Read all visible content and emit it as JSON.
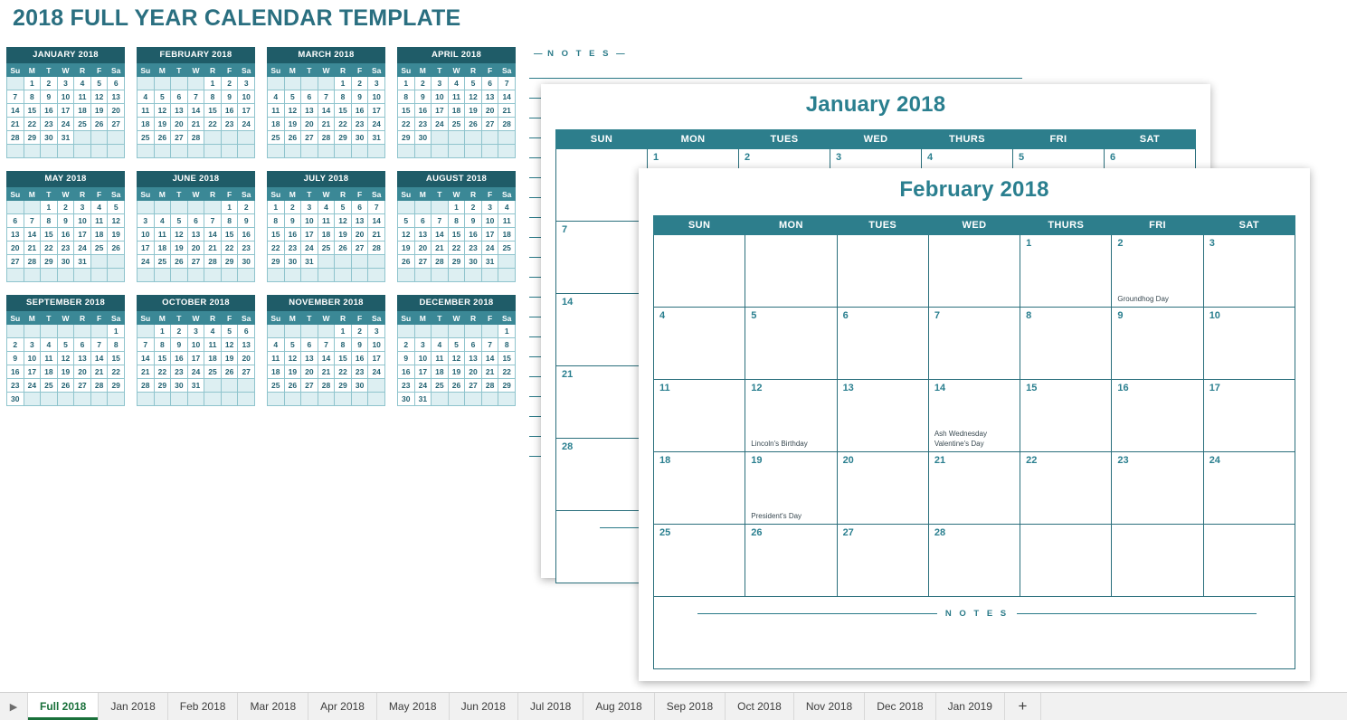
{
  "page_title": "2018 FULL YEAR CALENDAR TEMPLATE",
  "colors": {
    "brand_teal": "#2a7f8f",
    "mini_title_bg": "#1f5c68",
    "mini_header_bg": "#3b8896",
    "big_header_bg": "#2d7e8c",
    "shaded_cell": "#b4dbe2",
    "pad_cell": "#ddeff2",
    "notes_panel": "#dceff3",
    "active_tab_green": "#19703a"
  },
  "notes_panel": {
    "label": "N O T E S",
    "dash_left": "—",
    "dash_right": "—",
    "line_count": 20
  },
  "mini_calendar": {
    "weekday_headers": [
      "Su",
      "M",
      "T",
      "W",
      "R",
      "F",
      "Sa"
    ],
    "months": [
      {
        "title": "JANUARY 2018",
        "lead_blanks": 1,
        "days": 31
      },
      {
        "title": "FEBRUARY 2018",
        "lead_blanks": 4,
        "days": 28
      },
      {
        "title": "MARCH 2018",
        "lead_blanks": 4,
        "days": 31
      },
      {
        "title": "APRIL 2018",
        "lead_blanks": 0,
        "days": 30
      },
      {
        "title": "MAY 2018",
        "lead_blanks": 2,
        "days": 31
      },
      {
        "title": "JUNE 2018",
        "lead_blanks": 5,
        "days": 30
      },
      {
        "title": "JULY 2018",
        "lead_blanks": 0,
        "days": 31
      },
      {
        "title": "AUGUST 2018",
        "lead_blanks": 3,
        "days": 31
      },
      {
        "title": "SEPTEMBER 2018",
        "lead_blanks": 6,
        "days": 30
      },
      {
        "title": "OCTOBER 2018",
        "lead_blanks": 1,
        "days": 31
      },
      {
        "title": "NOVEMBER 2018",
        "lead_blanks": 4,
        "days": 30
      },
      {
        "title": "DECEMBER 2018",
        "lead_blanks": 6,
        "days": 31
      }
    ]
  },
  "big_weekday_headers": [
    "SUN",
    "MON",
    "TUES",
    "WED",
    "THURS",
    "FRI",
    "SAT"
  ],
  "windows": [
    {
      "id": "january",
      "heading": "January 2018",
      "lead_blanks": 1,
      "days": 31,
      "weeks": 5,
      "events": {},
      "notes_label": "N O T E S"
    },
    {
      "id": "february",
      "heading": "February 2018",
      "lead_blanks": 4,
      "days": 28,
      "weeks": 5,
      "events": {
        "2": [
          "Groundhog Day"
        ],
        "12": [
          "Lincoln's Birthday"
        ],
        "14": [
          "Ash Wednesday",
          "Valentine's Day"
        ],
        "19": [
          "President's Day"
        ]
      },
      "notes_label": "N O T E S"
    }
  ],
  "tabbar": {
    "nav_icon": "▶",
    "add_label": "+",
    "tabs": [
      {
        "label": "Full 2018",
        "active": true
      },
      {
        "label": "Jan 2018",
        "active": false
      },
      {
        "label": "Feb 2018",
        "active": false
      },
      {
        "label": "Mar 2018",
        "active": false
      },
      {
        "label": "Apr 2018",
        "active": false
      },
      {
        "label": "May 2018",
        "active": false
      },
      {
        "label": "Jun 2018",
        "active": false
      },
      {
        "label": "Jul 2018",
        "active": false
      },
      {
        "label": "Aug 2018",
        "active": false
      },
      {
        "label": "Sep 2018",
        "active": false
      },
      {
        "label": "Oct 2018",
        "active": false
      },
      {
        "label": "Nov 2018",
        "active": false
      },
      {
        "label": "Dec 2018",
        "active": false
      },
      {
        "label": "Jan 2019",
        "active": false
      }
    ]
  }
}
